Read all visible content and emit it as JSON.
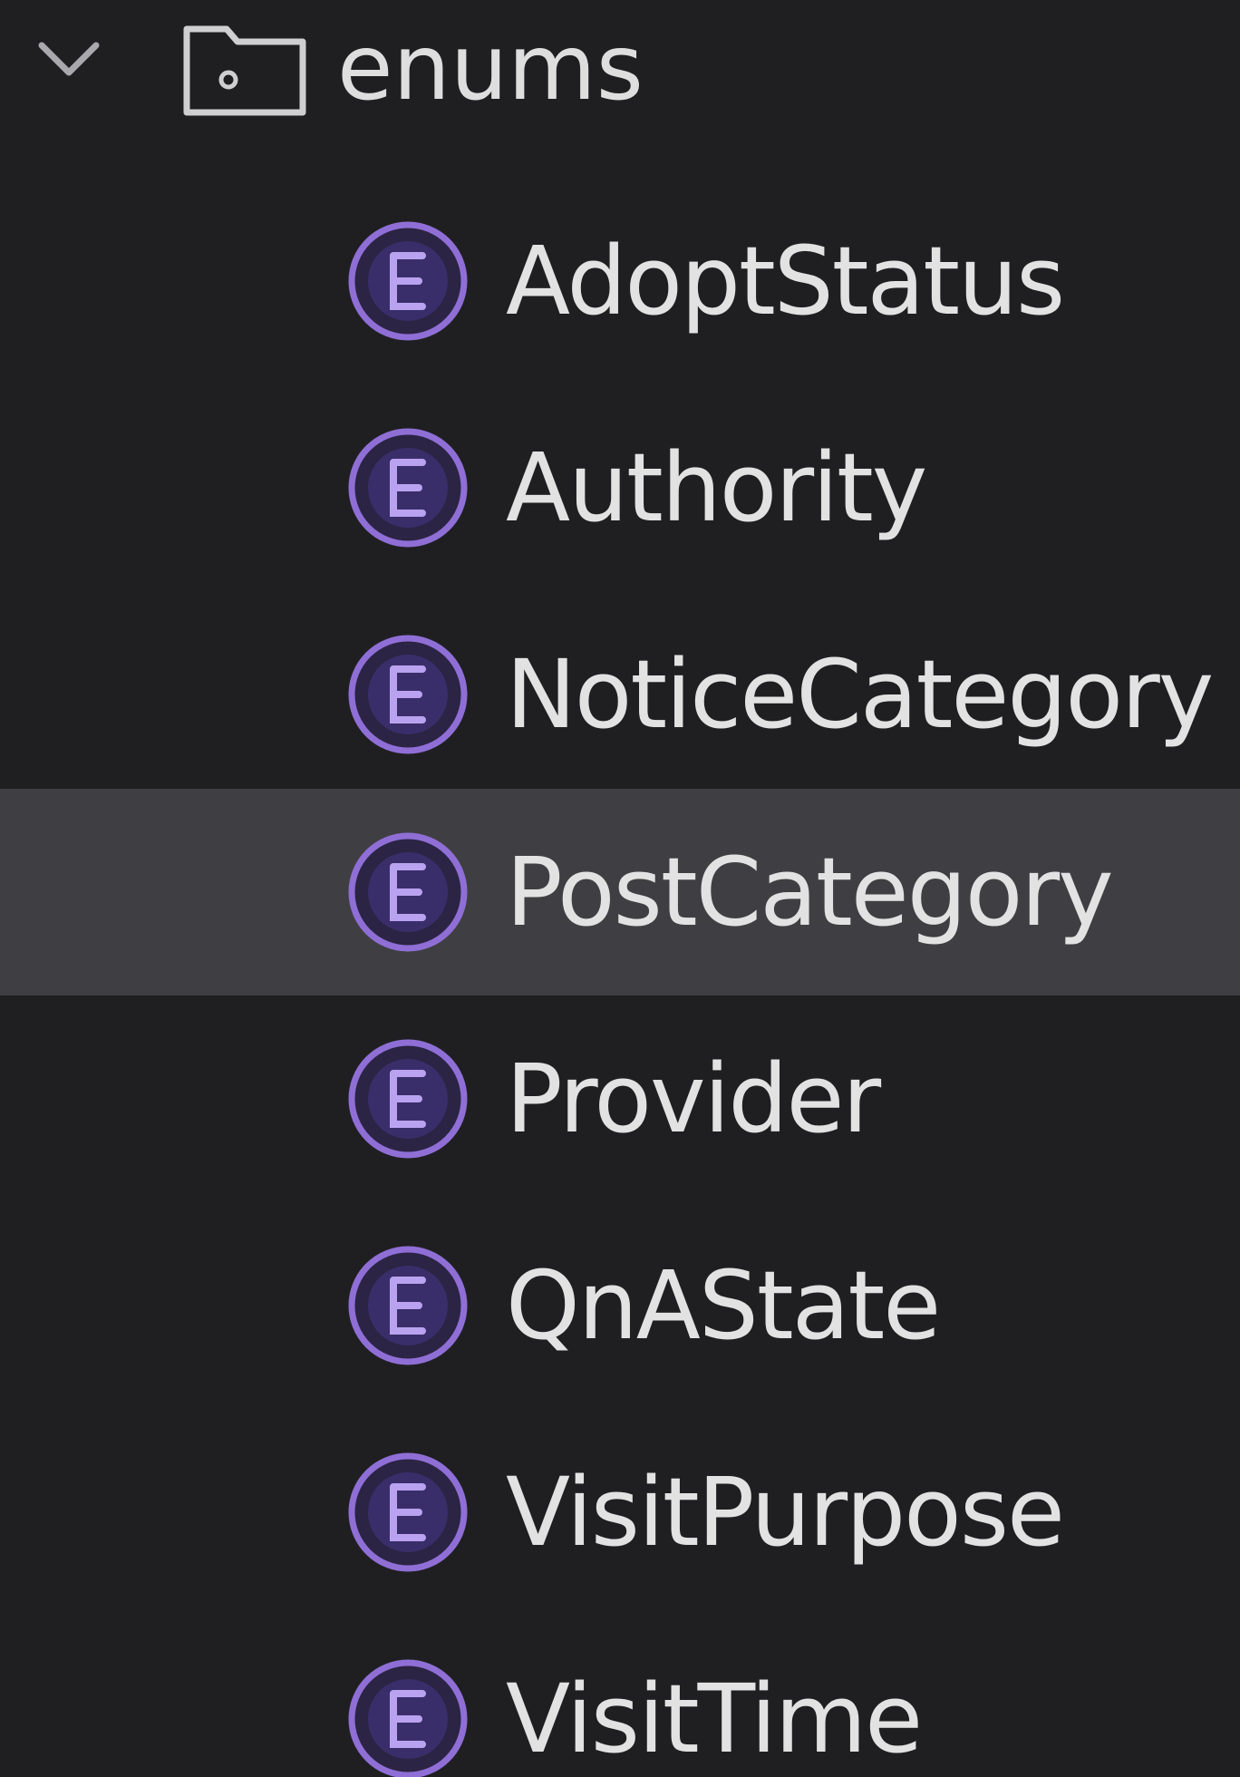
{
  "tree": {
    "folder": {
      "label": "enums",
      "icon": "folder-icon",
      "expanded": true
    },
    "items": [
      {
        "label": "AdoptStatus",
        "icon": "enum-icon"
      },
      {
        "label": "Authority",
        "icon": "enum-icon"
      },
      {
        "label": "NoticeCategory",
        "icon": "enum-icon"
      },
      {
        "label": "PostCategory",
        "icon": "enum-icon",
        "selected": true
      },
      {
        "label": "Provider",
        "icon": "enum-icon"
      },
      {
        "label": "QnAState",
        "icon": "enum-icon"
      },
      {
        "label": "VisitPurpose",
        "icon": "enum-icon"
      },
      {
        "label": "VisitTime",
        "icon": "enum-icon"
      }
    ]
  },
  "colors": {
    "background": "#1f1f22",
    "selected_row": "#3f3f43",
    "enum_icon": "#8f6fd6",
    "text": "#e2e2e2"
  }
}
